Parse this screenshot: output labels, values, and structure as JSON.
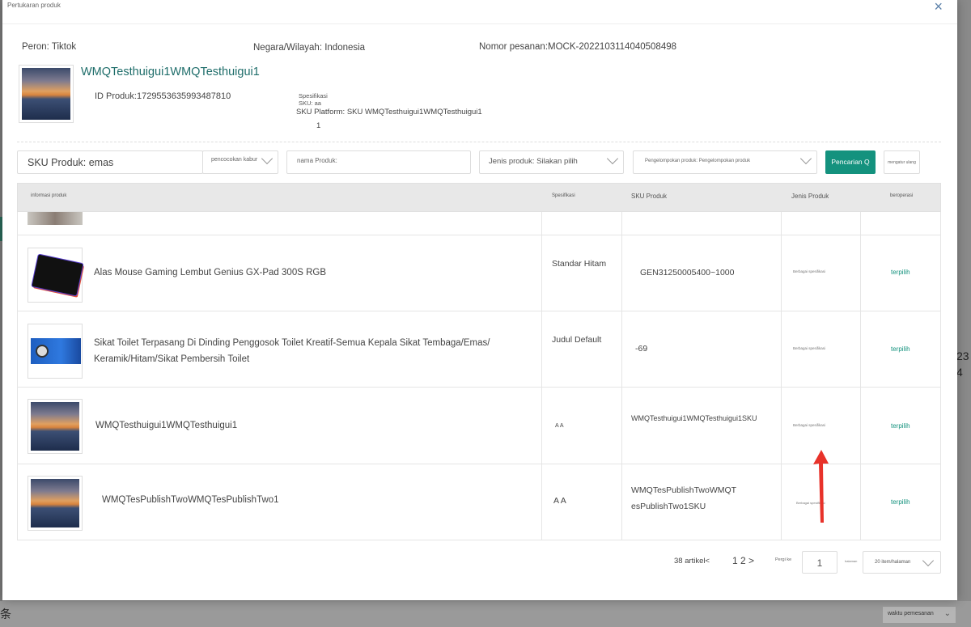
{
  "modal": {
    "title": "Pertukaran produk",
    "close_icon": "×"
  },
  "order_info": {
    "platform": "Peron: Tiktok",
    "country": "Negara/Wilayah: Indonesia",
    "order_no": "Nomor pesanan:MOCK-2022103114040508498"
  },
  "product": {
    "name": "WMQTesthuigui1WMQTesthuigui1",
    "id": "ID Produk:1729553635993487810",
    "spec_sku": "Spesifikasi SKU: aa",
    "sku_platform": "SKU Platform: SKU WMQTesthuigui1WMQTesthuigui1",
    "sku_platform_cont": "1"
  },
  "filters": {
    "sku_value": "SKU Produk: emas",
    "match_mode": "pencocokan kabur",
    "name_placeholder": "nama Produk:",
    "type_select": "Jenis produk: Silakan pilih",
    "group_select": "Pengelompokan produk: Pengelompokan produk",
    "search_label": "Pencarian Q",
    "reset_label": "mengatur ulang"
  },
  "table": {
    "headers": {
      "info": "informasi produk",
      "spec": "Spesifikasi",
      "sku": "SKU Produk",
      "type": "Jenis Produk",
      "action": "beroperasi"
    },
    "rows": [
      {
        "name": "Alas Mouse Gaming Lembut Genius GX-Pad 300S RGB",
        "spec": "Standar Hitam",
        "sku": "GEN31250005400~1000",
        "type": "Berbagai spesifikasi",
        "action": "terpilih"
      },
      {
        "name": "Sikat Toilet Terpasang Di Dinding Penggosok Toilet Kreatif-Semua Kepala Sikat Tembaga/Emas/ Keramik/Hitam/Sikat Pembersih Toilet",
        "spec": "Judul Default",
        "sku": "-69",
        "type": "Berbagai spesifikasi",
        "action": "terpilih"
      },
      {
        "name": "WMQTesthuigui1WMQTesthuigui1",
        "spec": "A A",
        "sku": "WMQTesthuigui1WMQTesthuigui1SKU",
        "type": "Berbagai spesifikasi",
        "action": "terpilih"
      },
      {
        "name": "WMQTesPublishTwoWMQTesPublishTwo1",
        "spec": "A A",
        "sku": "WMQTesPublishTwoWMQT esPublishTwo1SKU",
        "type": "Berbagai spesifikasi",
        "action": "terpilih"
      }
    ]
  },
  "pagination": {
    "total": "38 artikel<",
    "pages": "1 2 >",
    "goto_label": "Pergi ke",
    "goto_value": "1",
    "unit": "halaman",
    "page_size": "20 item/halaman"
  },
  "background": {
    "bottom_left": "条",
    "bottom_select": "waktu pemesanan",
    "right_text1": "23",
    "right_text2": "4"
  },
  "colors": {
    "accent": "#14927e",
    "title_link": "#1e6d6a",
    "arrow": "#e8322a"
  }
}
